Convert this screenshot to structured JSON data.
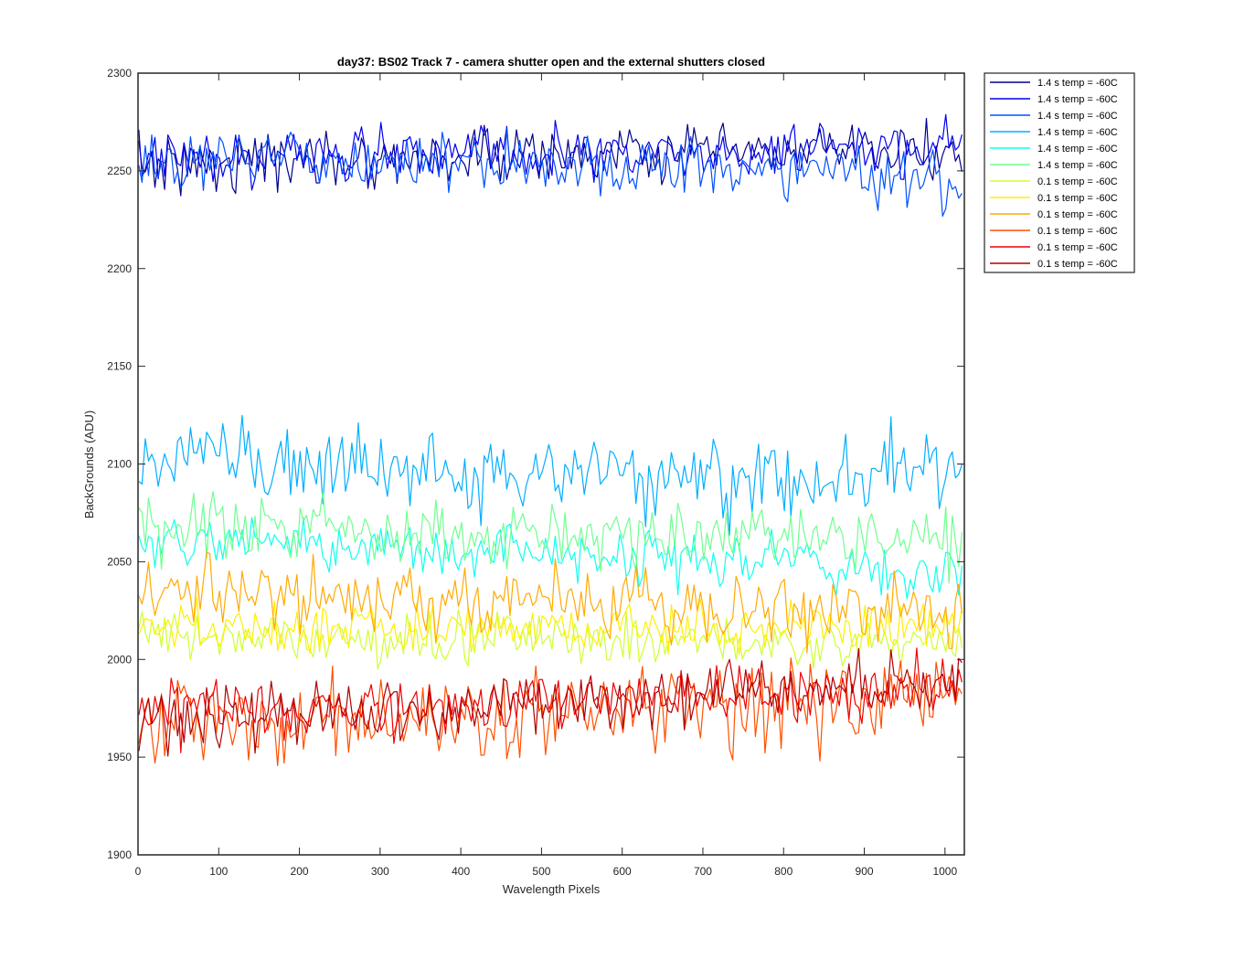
{
  "chart_data": {
    "type": "line",
    "title": "day37: BS02  Track 7 - camera shutter open and the external shutters closed",
    "xlabel": "Wavelength Pixels",
    "ylabel": "BackGrounds (ADU)",
    "xlim": [
      0,
      1024
    ],
    "ylim": [
      1900,
      2300
    ],
    "xticks": [
      0,
      100,
      200,
      300,
      400,
      500,
      600,
      700,
      800,
      900,
      1000
    ],
    "yticks": [
      1900,
      1950,
      2000,
      2050,
      2100,
      2150,
      2200,
      2250,
      2300
    ],
    "grid": false,
    "legend_position": "outside-top-right",
    "x_sampling": {
      "start": 1,
      "end": 1024,
      "step": 4
    },
    "series": [
      {
        "name": "1.4 s temp = -60C",
        "color": "#00008F",
        "mean": [
          2254,
          2256,
          2258,
          2259,
          2260
        ],
        "noise": 7
      },
      {
        "name": "1.4 s temp = -60C",
        "color": "#0000EF",
        "mean": [
          2257,
          2258,
          2258,
          2259,
          2260
        ],
        "noise": 7
      },
      {
        "name": "1.4 s temp = -60C",
        "color": "#0050FF",
        "mean": [
          2256,
          2255,
          2254,
          2253,
          2244
        ],
        "noise": 8
      },
      {
        "name": "1.4 s temp = -60C",
        "color": "#00AFFF",
        "mean": [
          2103,
          2099,
          2093,
          2090,
          2098
        ],
        "noise": 11
      },
      {
        "name": "1.4 s temp = -60C",
        "color": "#0FFFEF",
        "mean": [
          2062,
          2058,
          2055,
          2050,
          2043
        ],
        "noise": 7
      },
      {
        "name": "1.4 s temp = -60C",
        "color": "#6FFF8F",
        "mean": [
          2068,
          2066,
          2064,
          2062,
          2060
        ],
        "noise": 8
      },
      {
        "name": "0.1 s temp = -60C",
        "color": "#CFFF2F",
        "mean": [
          2012,
          2012,
          2010,
          2008,
          2010
        ],
        "noise": 6
      },
      {
        "name": "0.1 s temp = -60C",
        "color": "#FFEF00",
        "mean": [
          2016,
          2017,
          2016,
          2015,
          2018
        ],
        "noise": 6
      },
      {
        "name": "0.1 s temp = -60C",
        "color": "#FFAA00",
        "mean": [
          2034,
          2032,
          2029,
          2026,
          2025
        ],
        "noise": 9
      },
      {
        "name": "0.1 s temp = -60C",
        "color": "#FF5000",
        "mean": [
          1968,
          1970,
          1972,
          1976,
          1984
        ],
        "noise": 11
      },
      {
        "name": "0.1 s temp = -60C",
        "color": "#EF0000",
        "mean": [
          1974,
          1975,
          1979,
          1983,
          1990
        ],
        "noise": 8
      },
      {
        "name": "0.1 s temp = -60C",
        "color": "#B00000",
        "mean": [
          1970,
          1972,
          1979,
          1984,
          1988
        ],
        "noise": 8
      }
    ]
  }
}
